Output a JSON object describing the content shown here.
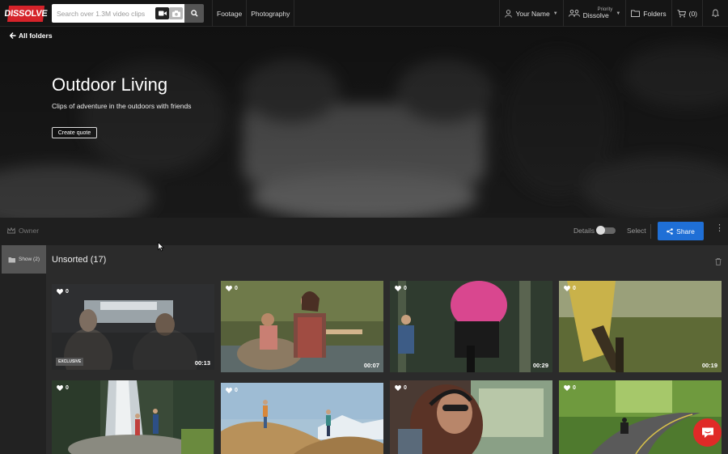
{
  "brand": {
    "logo_text": "DISSOLVE",
    "accent": "#d5232a"
  },
  "search": {
    "placeholder": "Search over 1.3M video clips"
  },
  "nav": {
    "links": [
      "Footage",
      "Photography"
    ],
    "user": "Your Name",
    "priority_small": "Priority",
    "priority_label": "Dissolve",
    "folders": "Folders",
    "cart": "(0)"
  },
  "hero": {
    "back_label": "All folders",
    "title": "Outdoor Living",
    "subtitle": "Clips of adventure in the outdoors with friends",
    "quote_button": "Create quote"
  },
  "toolbar": {
    "owner": "Owner",
    "details": "Details",
    "select": "Select",
    "share": "Share",
    "share_color": "#1f6fd6"
  },
  "sidebar": {
    "show_label": "Show (2)"
  },
  "section": {
    "title": "Unsorted (17)"
  },
  "clips": [
    {
      "likes": "0",
      "duration": "00:13",
      "badge": "EXCLUSIVE"
    },
    {
      "likes": "0",
      "duration": "00:07",
      "badge": ""
    },
    {
      "likes": "0",
      "duration": "00:29",
      "badge": ""
    },
    {
      "likes": "0",
      "duration": "00:19",
      "badge": ""
    },
    {
      "likes": "0",
      "duration": "",
      "badge": ""
    },
    {
      "likes": "0",
      "duration": "",
      "badge": ""
    },
    {
      "likes": "0",
      "duration": "",
      "badge": ""
    },
    {
      "likes": "0",
      "duration": "",
      "badge": ""
    }
  ]
}
